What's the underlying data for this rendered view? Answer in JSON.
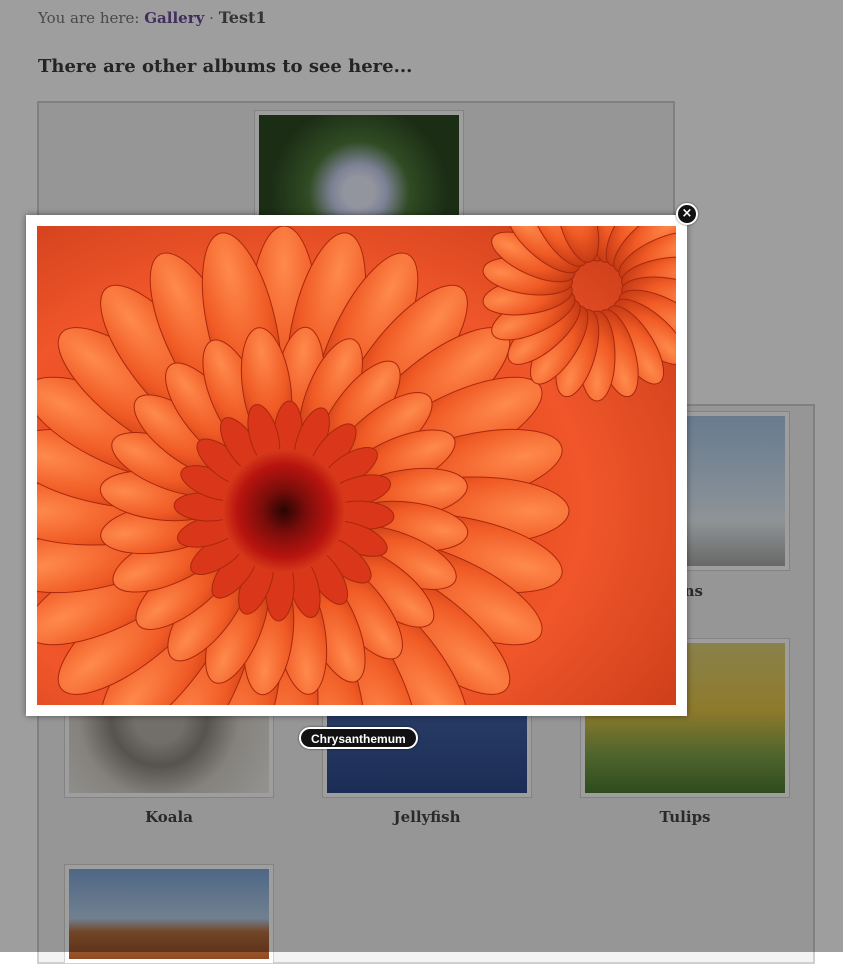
{
  "breadcrumb": {
    "prefix": "You are here:",
    "gallery_link": "Gallery",
    "separator": "·",
    "current": "Test1"
  },
  "heading": "There are other albums to see here...",
  "photos": [
    {
      "caption": "uins",
      "icon": "penguins-photo"
    },
    {
      "caption": "Koala",
      "icon": "koala-photo"
    },
    {
      "caption": "Jellyfish",
      "icon": "jellyfish-photo"
    },
    {
      "caption": "Tulips",
      "icon": "tulips-photo"
    }
  ],
  "lightbox": {
    "title": "Chrysanthemum",
    "close_symbol": "×",
    "close_icon": "close-icon"
  },
  "colors": {
    "link": "#6b4a9a",
    "overlay": "rgba(0,0,0,0.38)",
    "flower_primary": "#e8461a",
    "flower_center": "#a3130f"
  }
}
